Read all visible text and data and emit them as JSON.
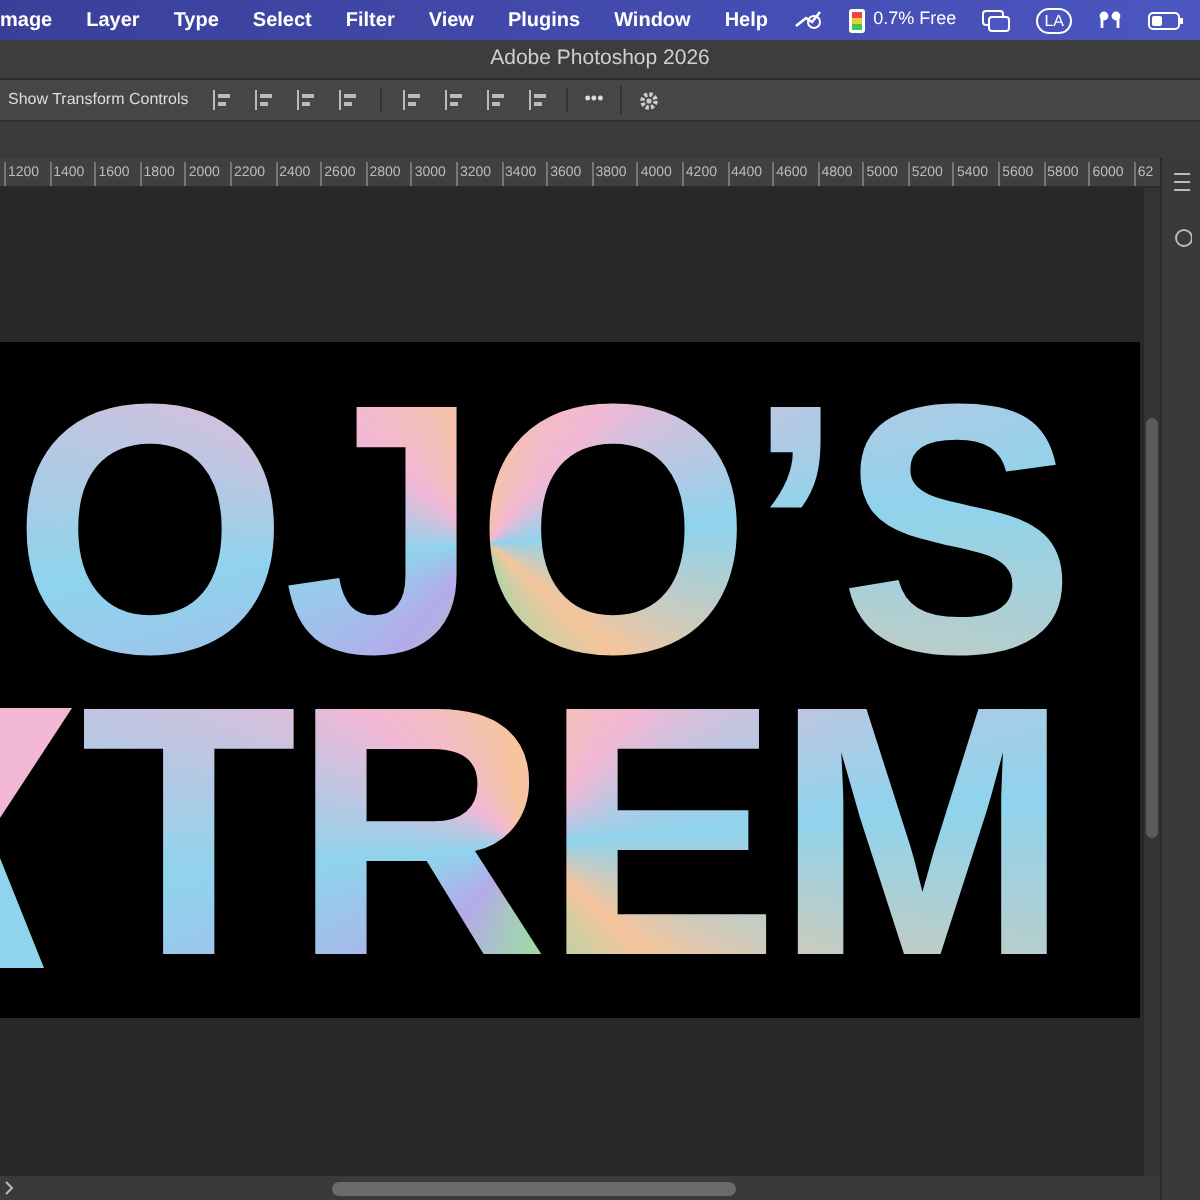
{
  "menu_bar": {
    "items": [
      "mage",
      "Layer",
      "Type",
      "Select",
      "Filter",
      "View",
      "Plugins",
      "Window",
      "Help"
    ],
    "memory": "0.7% Free",
    "input_source": "LA"
  },
  "window": {
    "title": "Adobe Photoshop 2026"
  },
  "options_bar": {
    "label": "Show Transform Controls",
    "more": "•••"
  },
  "ruler": {
    "labels": [
      "1200",
      "1400",
      "1600",
      "1800",
      "2000",
      "2200",
      "2400",
      "2600",
      "2800",
      "3000",
      "3200",
      "3400",
      "3600",
      "3800",
      "4000",
      "4200",
      "4400",
      "4600",
      "4800",
      "5000",
      "5200",
      "5400",
      "5600",
      "5800",
      "6000",
      "62"
    ]
  },
  "canvas": {
    "lines": [
      "OJO’S",
      "TREM"
    ]
  }
}
